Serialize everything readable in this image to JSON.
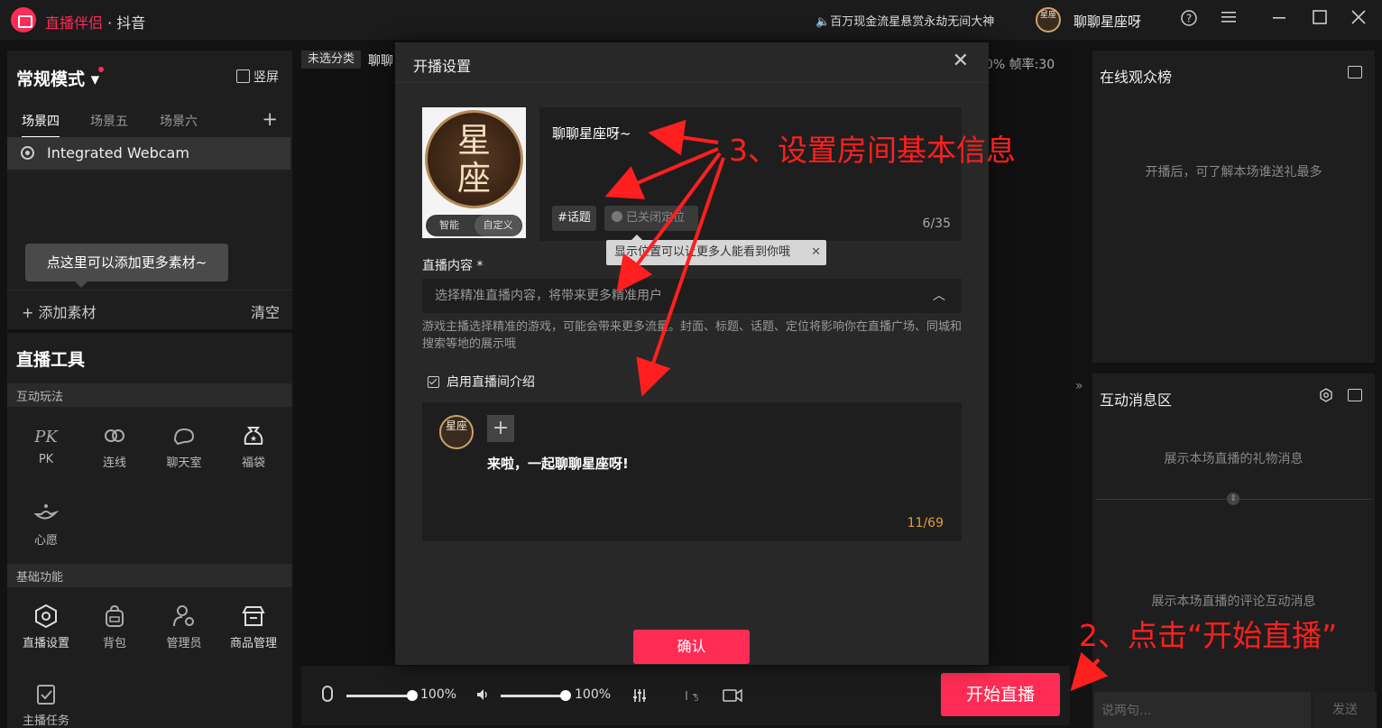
{
  "titlebar": {
    "app_name": "直播伴侣",
    "app_sub": " · 抖音",
    "notice": "百万现金流星悬赏永劫无间大神",
    "avatar_text": "星座",
    "username": "聊聊星座呀",
    "help_icon": "question-circle-icon",
    "menu_icon": "hamburger-icon"
  },
  "left": {
    "mode": "常规模式",
    "portrait": "竖屏",
    "scene_tabs": [
      "场景四",
      "场景五",
      "场景六"
    ],
    "source": "Integrated Webcam",
    "add_tip": "点这里可以添加更多素材~",
    "add_material": "+ 添加素材",
    "clear": "清空",
    "tools_title": "直播工具",
    "section_interactive": "互动玩法",
    "interactive_tools": [
      {
        "label": "PK",
        "icon": "pk-icon"
      },
      {
        "label": "连线",
        "icon": "link-icon"
      },
      {
        "label": "聊天室",
        "icon": "chatroom-icon"
      },
      {
        "label": "福袋",
        "icon": "lucky-bag-icon"
      },
      {
        "label": "心愿",
        "icon": "wish-lamp-icon"
      }
    ],
    "section_basic": "基础功能",
    "basic_tools": [
      {
        "label": "直播设置",
        "icon": "settings-hex-icon"
      },
      {
        "label": "背包",
        "icon": "backpack-icon"
      },
      {
        "label": "管理员",
        "icon": "admin-icon"
      },
      {
        "label": "商品管理",
        "icon": "shop-icon"
      },
      {
        "label": "主播任务",
        "icon": "task-icon"
      }
    ]
  },
  "center": {
    "category_tag": "未选分类",
    "title_partial": "聊聊",
    "fps": "0%  帧率:30",
    "mic_pct": "100%",
    "speaker_pct": "100%",
    "mic_level": 1.0,
    "speaker_level": 1.0,
    "start_live": "开始直播"
  },
  "right": {
    "audience_title": "在线观众榜",
    "audience_hint": "开播后，可了解本场谁送礼最多",
    "messages_title": "互动消息区",
    "gift_hint": "展示本场直播的礼物消息",
    "comment_hint": "展示本场直播的评论互动消息",
    "chat_placeholder": "说两句...",
    "send": "发送"
  },
  "modal": {
    "title": "开播设置",
    "cover_text": "星座",
    "cover_seg": [
      "智能",
      "自定义"
    ],
    "room_title": "聊聊星座呀~",
    "topic": "#话题",
    "location": "已关闭定位",
    "title_count": "6/35",
    "location_tip": "显示位置可以让更多人能看到你哦",
    "content_label": "直播内容 *",
    "content_placeholder": "选择精准直播内容，将带来更多精准用户",
    "content_help": "游戏主播选择精准的游戏，可能会带来更多流量。封面、标题、话题、定位将影响你在直播广场、同城和搜索等地的展示哦",
    "intro_check": "启用直播间介绍",
    "intro_avatar": "星座",
    "intro_msg": "来啦，一起聊聊星座呀!",
    "intro_count": "11/69",
    "confirm": "确认"
  },
  "annotations": {
    "step3": "3、设置房间基本信息",
    "step2": "2、点击“开始直播”",
    "color": "#ff1f1f"
  },
  "colors": {
    "accent": "#fe2c55",
    "panel": "#1e1e1e",
    "modal": "#282828"
  }
}
